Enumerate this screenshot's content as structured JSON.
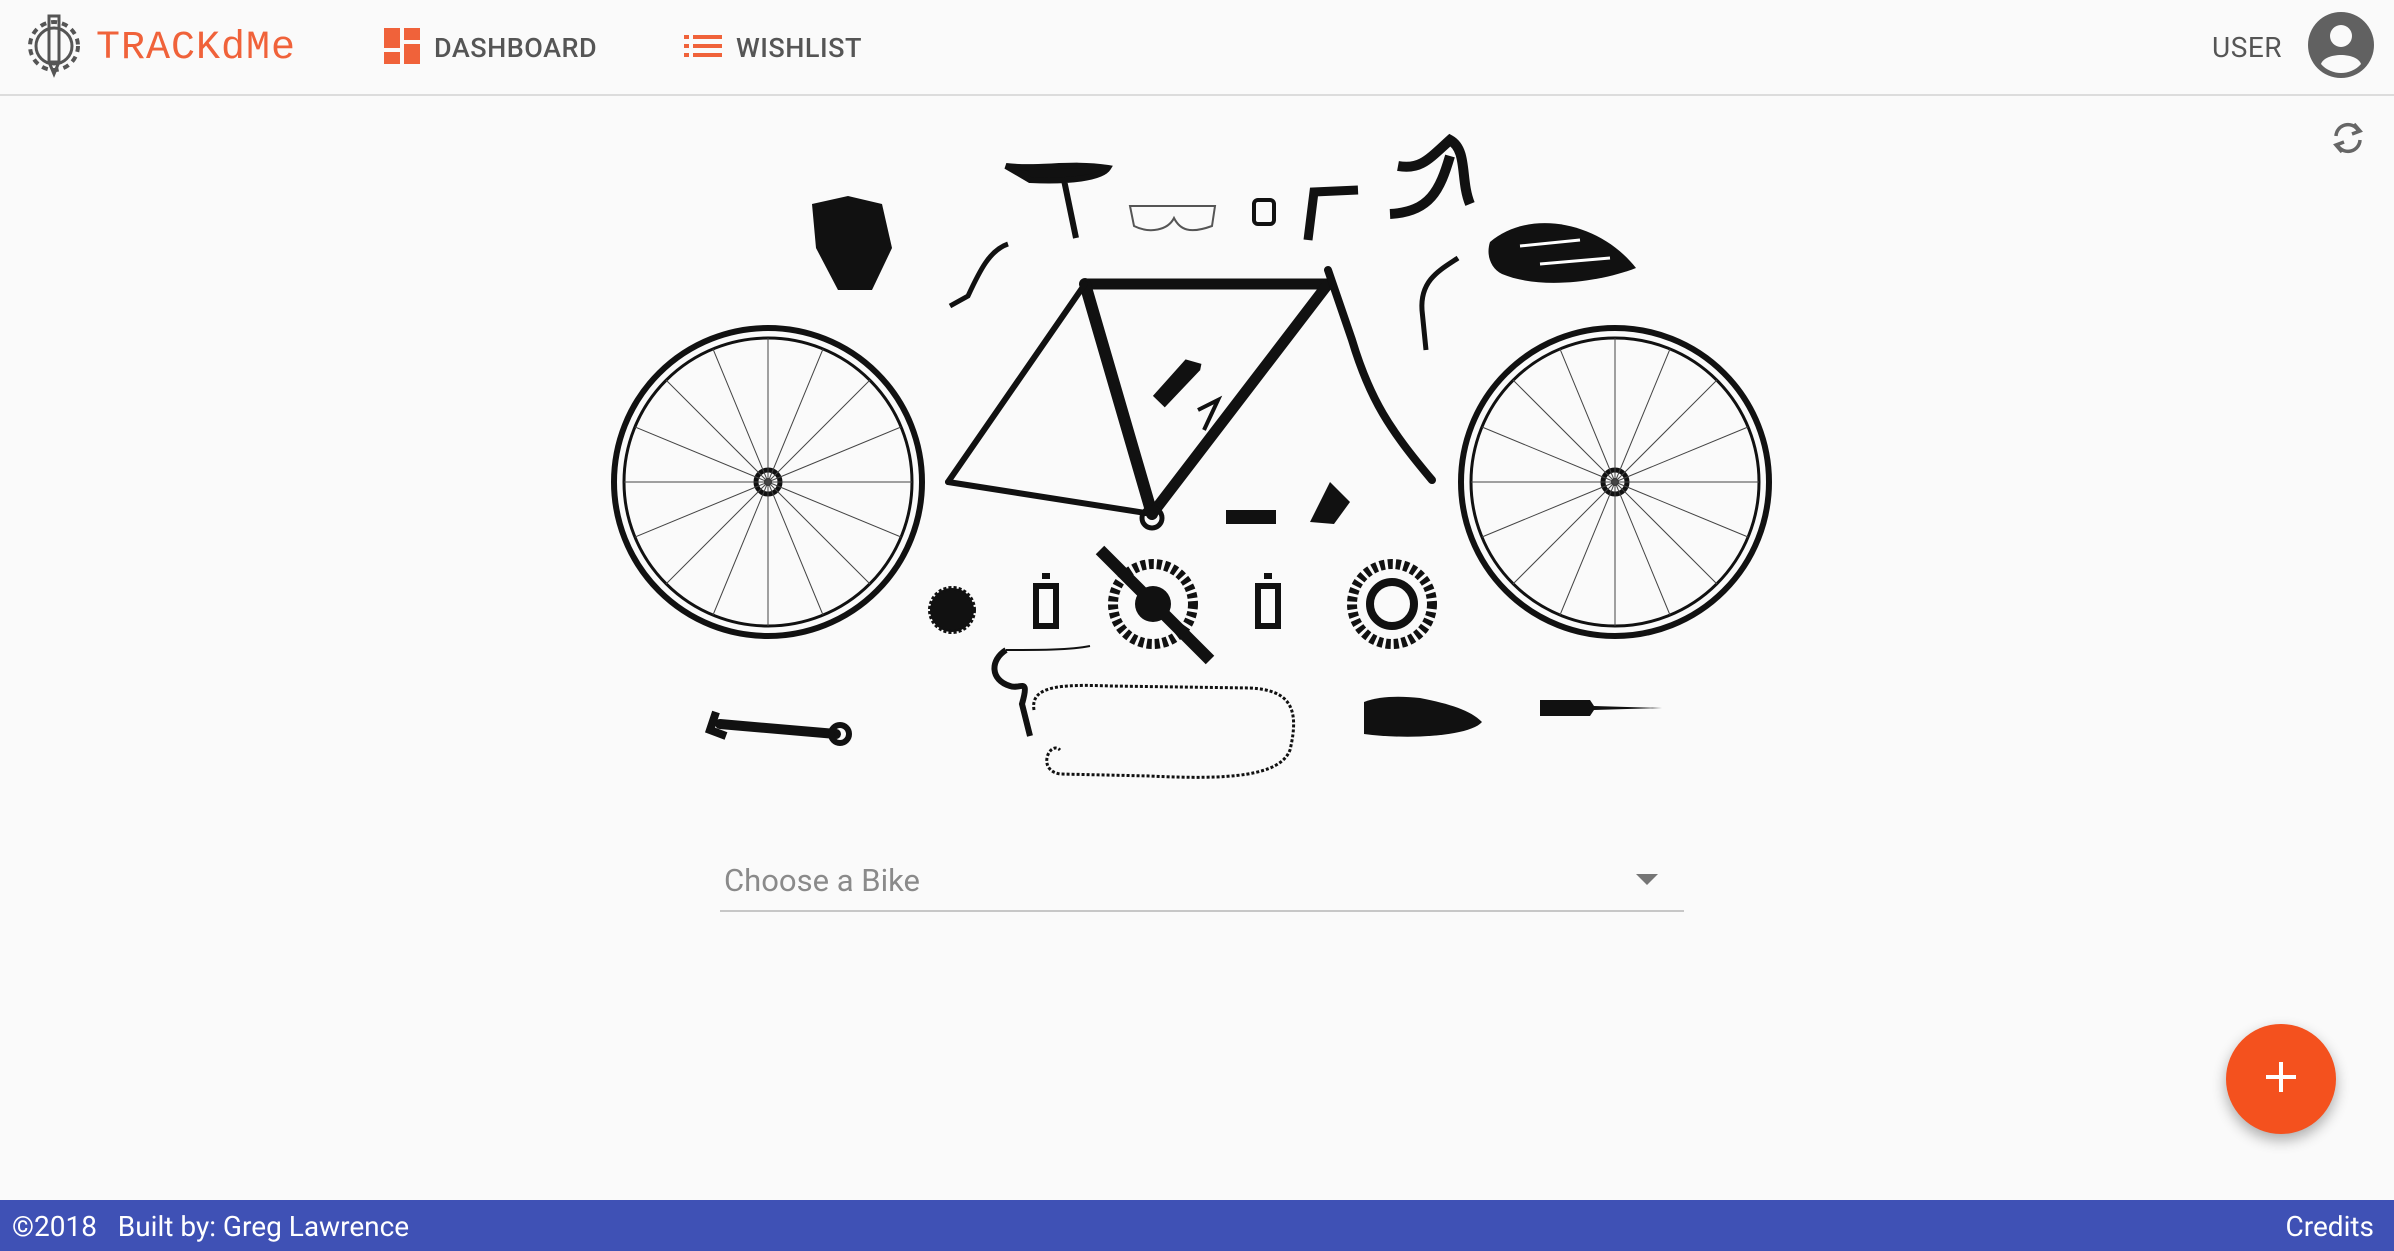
{
  "app": {
    "name": "TRACKdMe",
    "brand_color": "#f0623a",
    "accent_color": "#f4511e",
    "footer_color": "#3f51b5"
  },
  "nav": {
    "dashboard_label": "DASHBOARD",
    "wishlist_label": "WISHLIST",
    "user_label": "USER"
  },
  "icons": {
    "logo": "gear-pencil-logo-icon",
    "dashboard": "dashboard-icon",
    "wishlist": "list-icon",
    "user": "account-circle-icon",
    "refresh": "refresh-icon",
    "add": "plus-icon",
    "dropdown": "chevron-down-icon"
  },
  "main": {
    "bike_select_placeholder": "Choose a Bike"
  },
  "footer": {
    "copyright": "©2018   Built by: Greg Lawrence",
    "credits_label": "Credits"
  }
}
